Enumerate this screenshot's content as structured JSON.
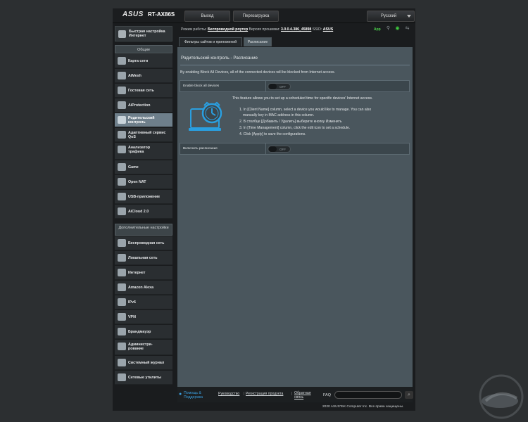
{
  "header": {
    "logo": "ASUS",
    "model": "RT-AX86S",
    "logout_label": "Выход",
    "reboot_label": "Перезагрузка",
    "language": "Русский"
  },
  "status": {
    "mode_label": "Режим работы:",
    "mode_value": "Беспроводной роутер",
    "firmware_label": "Версия прошивки:",
    "firmware_value": "3.0.0.4.386_45898",
    "ssid_label": "SSID:",
    "ssid_value": "ASUS",
    "app_label": "App"
  },
  "sidebar": {
    "quick": "Быстрая настройка Интернет",
    "general_header": "Общие",
    "general_items": [
      "Карта сети",
      "AiMesh",
      "Гостевая сеть",
      "AiProtection",
      "Родительский контроль",
      "Адаптивный сервис QoS",
      "Анализатор трафика",
      "Game",
      "Open NAT",
      "USB-приложение",
      "AiCloud 2.0"
    ],
    "advanced_header": "Дополнительные настройки",
    "advanced_items": [
      "Беспроводная сеть",
      "Локальная сеть",
      "Интернет",
      "Amazon Alexa",
      "IPv6",
      "VPN",
      "Брандмауэр",
      "Администри-рование",
      "Системный журнал",
      "Сетевые утилиты"
    ]
  },
  "tabs": {
    "filters": "Фильтры сайтов и приложений",
    "schedule": "Расписание"
  },
  "content": {
    "title": "Родительский контроль - Расписание",
    "description": "By enabling Block All Devices, all of the connected devices will be blocked from Internet access.",
    "block_all_label": "Enable block all devices",
    "toggle_off": "OFF",
    "feature_text": "This feature allows you to set up a scheduled time for specific devices' Internet access.",
    "instructions": [
      "1. In [Client Name] column, select a device you would like to manage. You can also",
      "manually key in MAC address in this column.",
      "2. В столбце [Добавить / Удалить] выберите кнопку Изменить",
      "3. In [Time Management] column, click the edit icon to set a schedule.",
      "4. Click [Apply] to save the configurations."
    ],
    "schedule_label": "Включить расписание"
  },
  "footer": {
    "help": "Помощь & Поддержка",
    "manual": "Руководство",
    "register": "Регистрация продукта",
    "feedback": "Обратная связь",
    "faq": "FAQ",
    "copyright": "2020 ASUSTeK Computer Inc. Все права защищены."
  },
  "colors": {
    "accent": "#6e7f8b",
    "panel": "#4a565d",
    "background": "#2c2f31"
  }
}
